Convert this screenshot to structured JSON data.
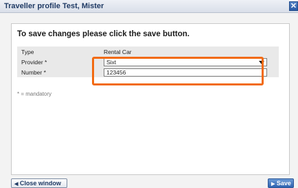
{
  "window": {
    "title": "Traveller profile Test, Mister",
    "close_glyph": "✕"
  },
  "main": {
    "heading": "To save changes please click the save button.",
    "rows": [
      {
        "label": "Type",
        "value": "Rental Car"
      },
      {
        "label": "Provider *",
        "value": "Sixt"
      },
      {
        "label": "Number *",
        "value": "123456"
      }
    ],
    "mandatory_note": "* = mandatory",
    "highlight_color": "#f26a10"
  },
  "footer": {
    "close_label": "Close window",
    "close_icon": "◀",
    "save_label": "Save",
    "save_icon": "▶"
  }
}
